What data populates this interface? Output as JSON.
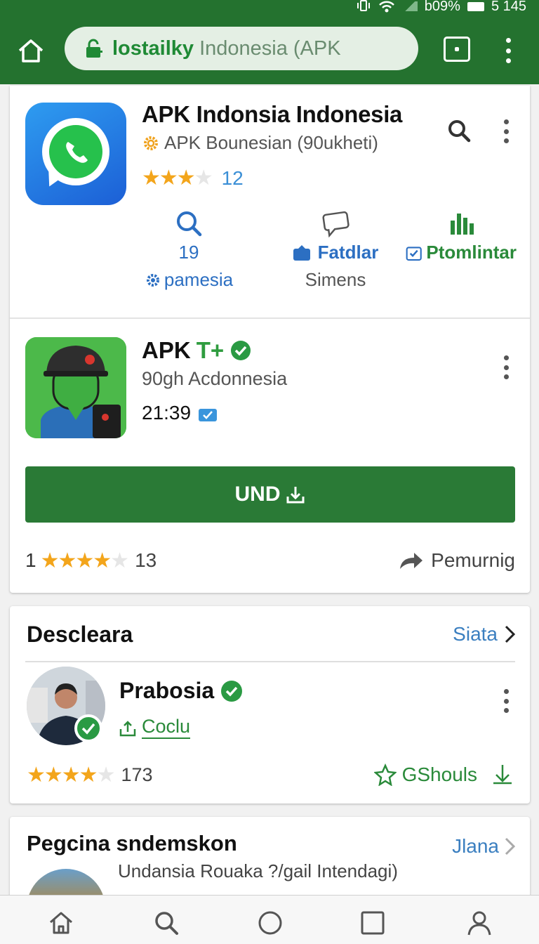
{
  "status_bar": {
    "battery": "b09%",
    "time": "5 145"
  },
  "browser": {
    "url_host": "lostailky",
    "url_rest": "Indonesia (APK"
  },
  "app1": {
    "title": "APK Indonsia Indonesia",
    "developer": "APK Bounesian (90ukheti)",
    "rating_count": "12",
    "stat1_value": "19",
    "stat1_label": "pamesia",
    "stat2_value": "Fatdlar",
    "stat2_label": "Simens",
    "stat3_value": "Ptomlintar"
  },
  "app2": {
    "title": "APK",
    "title_mark": "T+",
    "developer": "90gh Acdonnesia",
    "time": "21:39",
    "install_label": "UND",
    "rating_prefix": "1",
    "rating_count": "13",
    "share_label": "Pemurnig"
  },
  "section1": {
    "title": "Descleara",
    "link": "Siata",
    "person_name": "Prabosia",
    "person_tag": "Coclu",
    "rating_count": "173",
    "action_label": "GShouls"
  },
  "section2": {
    "title": "Pegcina sndemskon",
    "link": "Jlana",
    "subtitle": "Undansia Rouaka ?/gail Intendagi)"
  },
  "colors": {
    "brand_green": "#24722f",
    "accent_blue": "#3b7fc0",
    "star": "#f3a51b"
  },
  "icons": [
    "home-icon",
    "lock-icon",
    "tab-icon",
    "more-vertical-icon",
    "whatsapp-icon",
    "search-icon",
    "chat-bubble-icon",
    "bar-chart-icon",
    "settings-icon",
    "verified-icon",
    "share-icon",
    "star-icon",
    "download-icon",
    "chevron-right-icon",
    "circle-icon",
    "square-icon",
    "person-icon"
  ]
}
